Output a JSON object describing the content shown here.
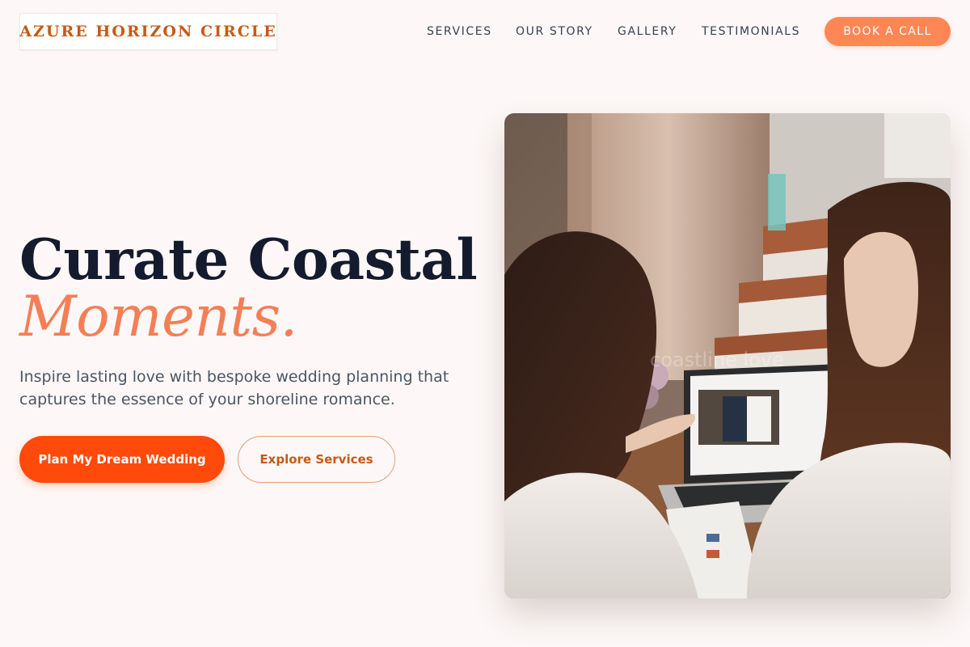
{
  "header": {
    "brand": "AZURE HORIZON CIRCLE",
    "nav": [
      "SERVICES",
      "OUR STORY",
      "GALLERY",
      "TESTIMONIALS"
    ],
    "cta": "BOOK A CALL"
  },
  "hero": {
    "title_line1": "Curate Coastal",
    "title_line2": "Moments.",
    "subtitle": "Inspire lasting love with bespoke wedding planning that captures the essence of your shoreline romance.",
    "primary_button": "Plan My Dream Wedding",
    "secondary_button": "Explore Services",
    "image": {
      "alt": "Two women looking at wedding photos on a laptop",
      "overlay_text": "coastline love"
    }
  },
  "colors": {
    "background": "#fdf8f7",
    "brand": "#c75a14",
    "accent": "#ff8655",
    "primary": "#ff4a0b",
    "title": "#151b2e",
    "title_accent": "#f47f56"
  }
}
